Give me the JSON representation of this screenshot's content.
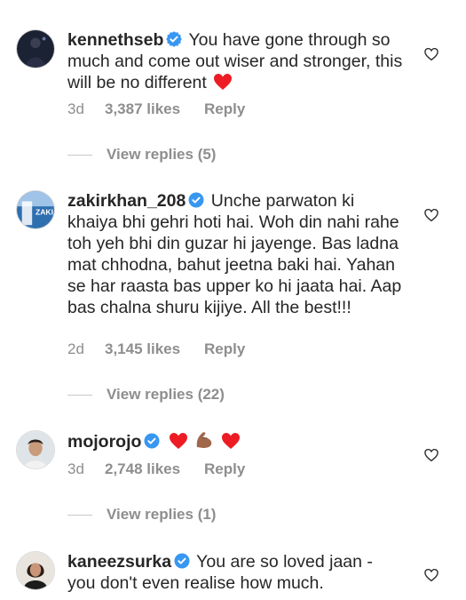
{
  "comments": [
    {
      "username": "kennethseb",
      "text": "You have gone through so much and come out wiser and stronger, this will be no different",
      "age": "3d",
      "likes": "3,387 likes",
      "reply_label": "Reply",
      "view_replies": "View replies (5)",
      "avatar": "concert-photo"
    },
    {
      "username": "zakirkhan_208",
      "text": "Unche parwaton ki khaiya bhi gehri hoti hai. Woh din nahi rahe toh yeh bhi din guzar hi jayenge. Bas ladna mat chhodna, bahut jeetna baki hai. Yahan se har raasta bas upper ko hi jaata hai. Aap bas chalna shuru kijiye. All the best!!!",
      "age": "2d",
      "likes": "3,145 likes",
      "reply_label": "Reply",
      "view_replies": "View replies (22)",
      "avatar": "blue-poster"
    },
    {
      "username": "mojorojo",
      "text": "",
      "age": "3d",
      "likes": "2,748 likes",
      "reply_label": "Reply",
      "view_replies": "View replies (1)",
      "avatar": "man-portrait"
    },
    {
      "username": "kaneezsurka",
      "text": "You are so loved jaan - you don't even realise how much.",
      "avatar": "woman-portrait"
    }
  ],
  "icons": {
    "verified": "verified-badge-icon",
    "like": "heart-outline-icon",
    "emoji_heart": "red-heart-emoji",
    "emoji_flex": "flexed-biceps-emoji"
  },
  "colors": {
    "verified": "#3897f0",
    "muted": "#8e8e8e",
    "heart": "#ed1c24"
  }
}
